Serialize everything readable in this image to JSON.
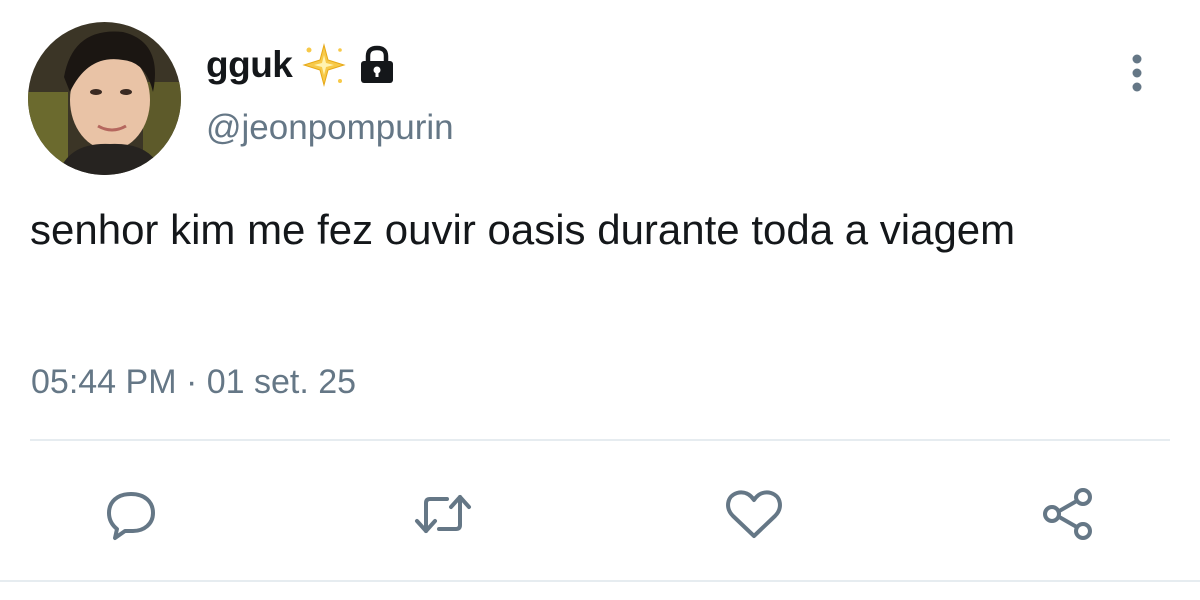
{
  "user": {
    "display_name": "gguk",
    "handle": "@jeonpompurin",
    "badges": [
      "sparkle-icon",
      "lock-icon"
    ],
    "avatar": "profile-photo"
  },
  "tweet": {
    "text": "senhor kim me fez ouvir oasis durante toda a viagem",
    "timestamp": "05:44 PM · 01 set. 25"
  },
  "actions": [
    "reply-icon",
    "retweet-icon",
    "like-icon",
    "share-icon"
  ],
  "colors": {
    "text": "#14171a",
    "secondary_text": "#657786",
    "divider": "#e6ecf0",
    "icon": "#657786",
    "sparkle": "#f7c948"
  }
}
